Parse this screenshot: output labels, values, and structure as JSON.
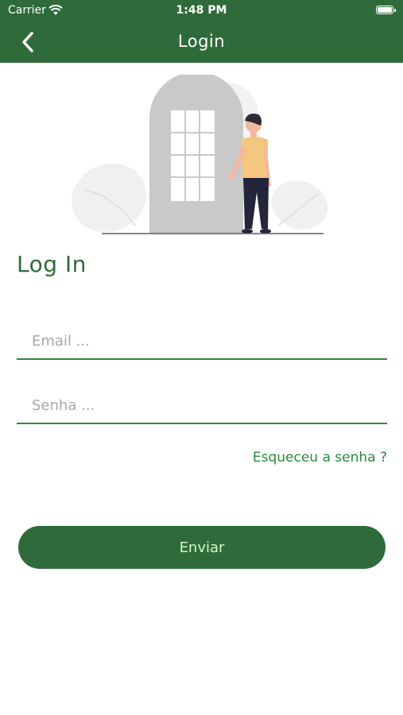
{
  "status_bar": {
    "carrier": "Carrier",
    "time": "1:48 PM"
  },
  "nav": {
    "title": "Login",
    "back_icon": "chevron-left-icon"
  },
  "form": {
    "heading": "Log In",
    "email": {
      "placeholder": "Email ...",
      "value": ""
    },
    "password": {
      "placeholder": "Senha ...",
      "value": ""
    },
    "forgot_label": "Esqueceu a senha ?",
    "submit_label": "Enviar"
  },
  "colors": {
    "primary": "#2f6b3a",
    "accent": "#2a8a3a",
    "button_text": "#d6f5c9"
  }
}
